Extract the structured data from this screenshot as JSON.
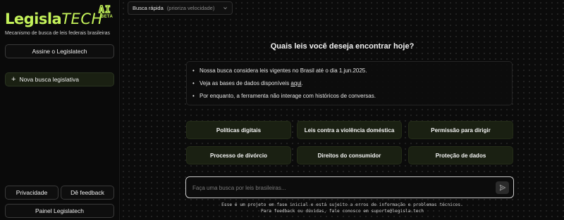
{
  "sidebar": {
    "logo_main": "Legisla",
    "logo_tech": "TECH",
    "logo_ai": "AI",
    "logo_beta": "BETA",
    "tagline": "Mecanismo de busca de leis federais brasileiras",
    "subscribe_label": "Assine o Legislatech",
    "new_search_label": "Nova busca legislativa",
    "privacy_label": "Privacidade",
    "feedback_label": "Dê feedback",
    "panel_label": "Painel Legislatech"
  },
  "header": {
    "mode_label": "Busca rápida",
    "mode_hint": "(prioriza velocidade)"
  },
  "main": {
    "question": "Quais leis você deseja encontrar hoje?",
    "info": {
      "item1": "Nossa busca considera leis vigentes no Brasil até o dia 1.jun.2025.",
      "item2_prefix": "Veja as bases de dados disponíveis ",
      "item2_link": "aqui",
      "item2_suffix": ".",
      "item3": "Por enquanto, a ferramenta não interage com históricos de conversas."
    },
    "suggestions": [
      "Políticas digitais",
      "Leis contra a violência doméstica",
      "Permissão para dirigir",
      "Processo de divórcio",
      "Direitos do consumidor",
      "Proteção de dados"
    ],
    "search_placeholder": "Faça uma busca por leis brasileiras...",
    "disclaimer_line1": "Esse é um projeto em fase inicial e está sujeito a erros de informação e problemas técnicos.",
    "disclaimer_line2": "Para feedback ou dúvidas, fale conosco em suporte@legisla.tech"
  },
  "icons": {
    "mode_chevron": "chevron-down-icon",
    "new_search": "plus-icon",
    "send": "send-icon"
  },
  "colors": {
    "brand": "#c4f25a",
    "chip_bg": "#1a2012",
    "background": "#0a0a0a"
  }
}
